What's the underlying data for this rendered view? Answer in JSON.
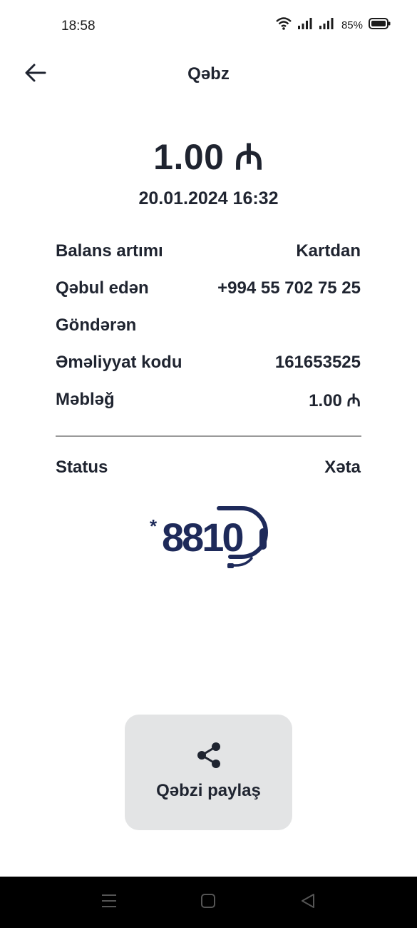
{
  "status_bar": {
    "time": "18:58",
    "battery": "85%",
    "icons": [
      "wifi-icon",
      "signal-icon",
      "signal-icon",
      "battery-icon"
    ]
  },
  "header": {
    "title": "Qəbz",
    "back_icon": "arrow-left-icon"
  },
  "receipt": {
    "amount": "1.00 ₼",
    "datetime": "20.01.2024 16:32",
    "rows": [
      {
        "label": "Balans artımı",
        "value": "Kartdan"
      },
      {
        "label": "Qəbul edən",
        "value": "+994 55 702 75 25"
      },
      {
        "label": "Göndərən",
        "value": ""
      },
      {
        "label": "Əməliyyat kodu",
        "value": "161653525"
      },
      {
        "label": "Məbləğ",
        "value": "1.00 ₼"
      }
    ],
    "status_label": "Status",
    "status_value": "Xəta"
  },
  "hotline": {
    "star": "*",
    "number": "8810",
    "icon": "headset-icon",
    "color": "#1e2a5a"
  },
  "share": {
    "label": "Qəbzi paylaş",
    "icon": "share-icon"
  },
  "nav_bar": {
    "icons": [
      "menu-icon",
      "home-icon",
      "back-icon"
    ]
  }
}
